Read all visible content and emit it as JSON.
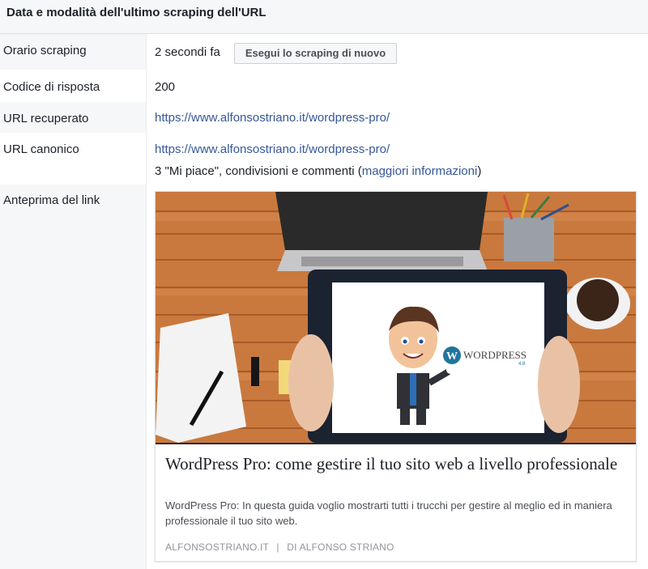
{
  "header": {
    "title": "Data e modalità dell'ultimo scraping dell'URL"
  },
  "rows": {
    "scrape_time": {
      "label": "Orario scraping",
      "value": "2 secondi fa",
      "button": "Esegui lo scraping di nuovo"
    },
    "response_code": {
      "label": "Codice di risposta",
      "value": "200"
    },
    "fetched_url": {
      "label": "URL recuperato",
      "value": "https://www.alfonsostriano.it/wordpress-pro/"
    },
    "canonical_url": {
      "label": "URL canonico",
      "value": "https://www.alfonsostriano.it/wordpress-pro/",
      "engagement_prefix": "3 \"Mi piace\", condivisioni e commenti (",
      "engagement_link": "maggiori informazioni",
      "engagement_suffix": ")"
    },
    "link_preview": {
      "label": "Anteprima del link"
    }
  },
  "preview_card": {
    "title": "WordPress Pro: come gestire il tuo sito web a livello professionale",
    "description": "WordPress Pro: In questa guida voglio mostrarti tutti i trucchi per gestire al meglio ed in maniera professionale il tuo sito web.",
    "domain": "ALFONSOSTRIANO.IT",
    "separator": "|",
    "author": "DI ALFONSO STRIANO",
    "image": {
      "logo_text": "WORDPRESS",
      "logo_letter": "W",
      "version": "4.8"
    }
  },
  "colors": {
    "link": "#365899",
    "header_bg": "#f6f7f9",
    "wood": "#c9793e"
  }
}
